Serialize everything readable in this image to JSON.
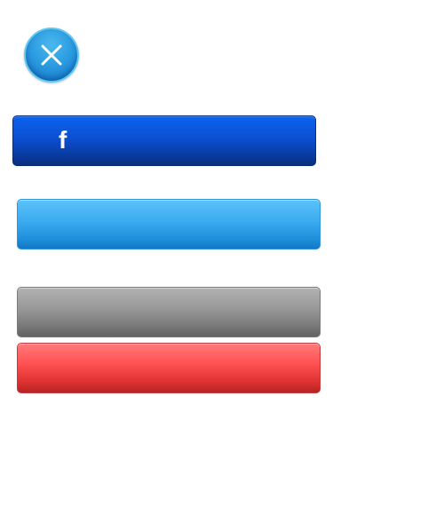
{
  "close_button": {
    "icon": "close-icon",
    "ring_color": "#5fc8f2",
    "fill_color": "#2a9ae0"
  },
  "buttons": {
    "facebook": {
      "icon": "facebook-icon",
      "glyph": "f",
      "label": "",
      "color": "#0b4fd2"
    },
    "light_blue": {
      "label": "",
      "color": "#3aaaf0"
    },
    "gray": {
      "label": "",
      "color": "#8c8c8c"
    },
    "red": {
      "label": "",
      "color": "#ff5252"
    }
  }
}
